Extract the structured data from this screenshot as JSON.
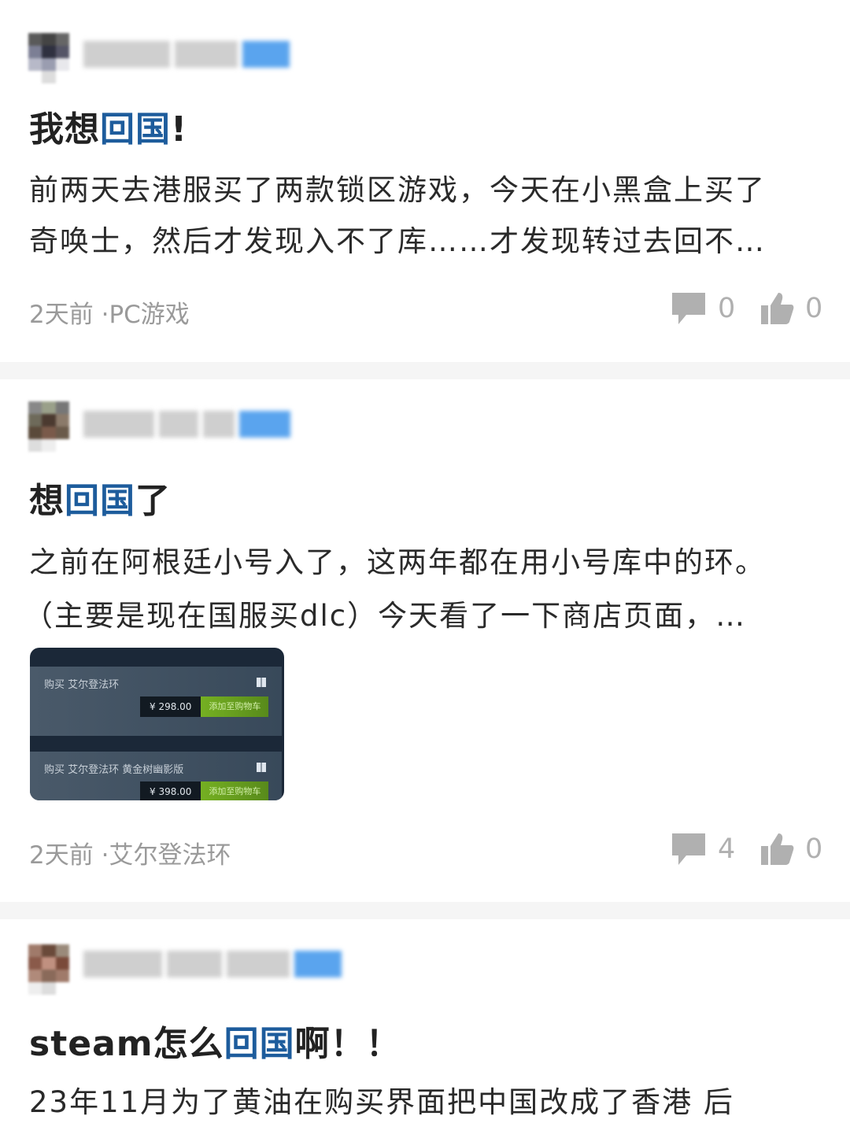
{
  "posts": [
    {
      "title_pre": "我想",
      "title_kw": "回国",
      "title_post": "!",
      "lines": [
        "前两天去港服买了两款锁区游戏，今天在小黑盒上买了",
        "奇唤士，然后才发现入不了库……才发现转过去回不…"
      ],
      "time": "2天前",
      "sep": " ·",
      "category": "PC游戏",
      "comments": "0",
      "likes": "0"
    },
    {
      "title_pre": "想",
      "title_kw": "回国",
      "title_post": "了",
      "lines": [
        "之前在阿根廷小号入了，这两年都在用小号库中的环。",
        "（主要是现在国服买dlc）今天看了一下商店页面，…"
      ],
      "attachment": {
        "items": [
          {
            "label": "购买 艾尔登法环",
            "price": "¥ 298.00",
            "button": "添加至购物车"
          },
          {
            "label": "购买 艾尔登法环 黄金树幽影版",
            "price": "¥ 398.00",
            "button": "添加至购物车"
          }
        ]
      },
      "time": "2天前",
      "sep": " ·",
      "category": "艾尔登法环",
      "comments": "4",
      "likes": "0"
    },
    {
      "title_pre": "steam怎么",
      "title_kw": "回国",
      "title_post": "啊！！",
      "lines": [
        "23年11月为了黄油在购买界面把中国改成了香港      后"
      ]
    }
  ],
  "colors": {
    "keyword": "#1d5c9c",
    "meta": "#9a9a9a",
    "icon": "#b0b0b0",
    "divider": "#f5f5f5"
  },
  "icons": {
    "comment": "comment-bubble-icon",
    "like": "thumbs-up-icon",
    "platform": "windows-icon"
  }
}
